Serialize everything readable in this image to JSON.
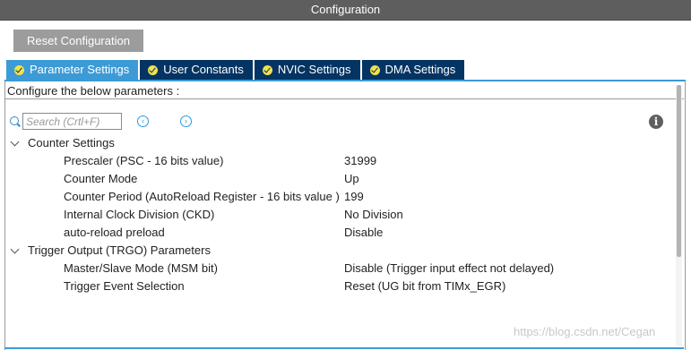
{
  "window": {
    "title": "Configuration"
  },
  "toolbar": {
    "reset_label": "Reset Configuration"
  },
  "tabs": [
    {
      "label": "Parameter Settings",
      "active": true
    },
    {
      "label": "User Constants",
      "active": false
    },
    {
      "label": "NVIC Settings",
      "active": false
    },
    {
      "label": "DMA Settings",
      "active": false
    }
  ],
  "panel": {
    "header": "Configure the below parameters :"
  },
  "search": {
    "placeholder": "Search (Crtl+F)",
    "value": ""
  },
  "icons": {
    "search": "search-icon",
    "prev": "arrow-left-circle-icon",
    "next": "arrow-right-circle-icon",
    "info": "info-icon",
    "tab_status": "check-circle-icon",
    "group_toggle": "chevron-down-icon"
  },
  "groups": [
    {
      "label": "Counter Settings",
      "params": [
        {
          "name": "Prescaler (PSC - 16 bits value)",
          "value": "31999"
        },
        {
          "name": "Counter Mode",
          "value": "Up"
        },
        {
          "name": "Counter Period (AutoReload Register - 16 bits value )",
          "value": "199"
        },
        {
          "name": "Internal Clock Division (CKD)",
          "value": "No Division"
        },
        {
          "name": "auto-reload preload",
          "value": "Disable"
        }
      ]
    },
    {
      "label": "Trigger Output (TRGO) Parameters",
      "params": [
        {
          "name": "Master/Slave Mode (MSM bit)",
          "value": "Disable (Trigger input effect not delayed)"
        },
        {
          "name": "Trigger Event Selection",
          "value": "Reset (UG bit from TIMx_EGR)"
        }
      ]
    }
  ],
  "watermark": "https://blog.csdn.net/Cegan",
  "colors": {
    "title_bar": "#5e5e5e",
    "tab_active": "#3c9ad6",
    "tab_inactive": "#043463",
    "tab_check": "#f2e14a",
    "reset_button": "#9c9c9c"
  }
}
